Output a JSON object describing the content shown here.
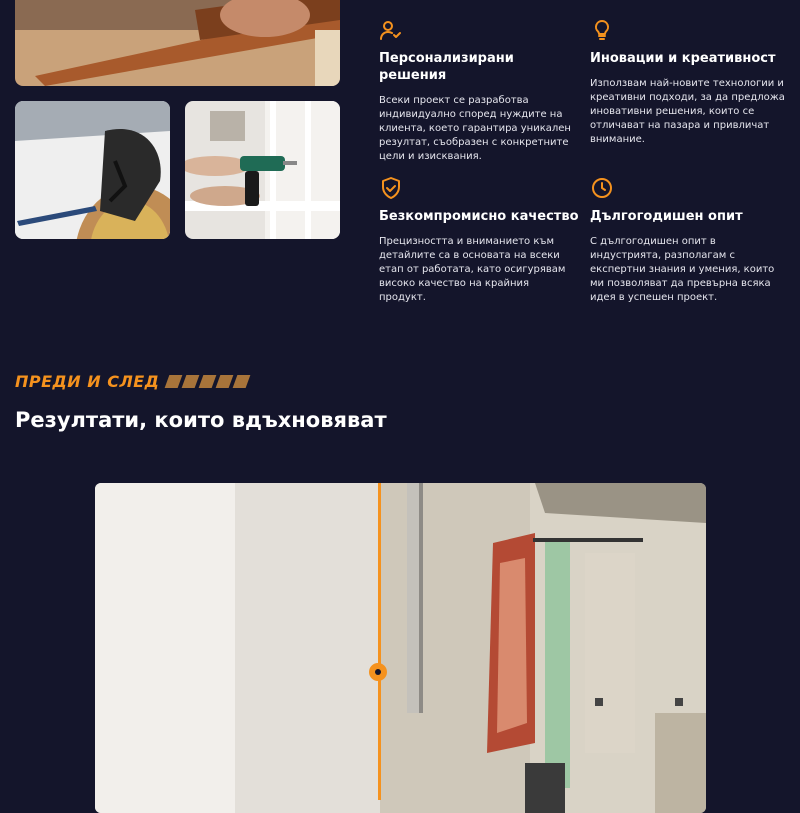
{
  "features": [
    {
      "icon": "user-check-icon",
      "title": "Персонализирани решения",
      "text": "Всеки проект се разработва индивидуално според нуждите на клиента, което гарантира уникален резултат, съобразен с конкретните цели и изисквания."
    },
    {
      "icon": "lightbulb-icon",
      "title": "Иновации и креативност",
      "text": "Използвам най-новите технологии и креативни подходи, за да предложа иновативни решения, които се отличават на пазара и привличат внимание."
    },
    {
      "icon": "shield-check-icon",
      "title": "Безкомпромисно качество",
      "text": "Прецизността и вниманието към детайлите са в основата на всеки етап от работата, като осигурявам високо качество на крайния продукт."
    },
    {
      "icon": "clock-icon",
      "title": "Дългогодишен опит",
      "text": "С дългогодишен опит в индустрията, разполагам с експертни знания и умения, които ми позволяват да превърна всяка идея в успешен проект."
    }
  ],
  "section": {
    "eyebrow": "ПРЕДИ И СЛЕД",
    "headline": "Резултати, които вдъхновяват"
  },
  "colors": {
    "background": "#14152b",
    "accent": "#f5921e"
  }
}
